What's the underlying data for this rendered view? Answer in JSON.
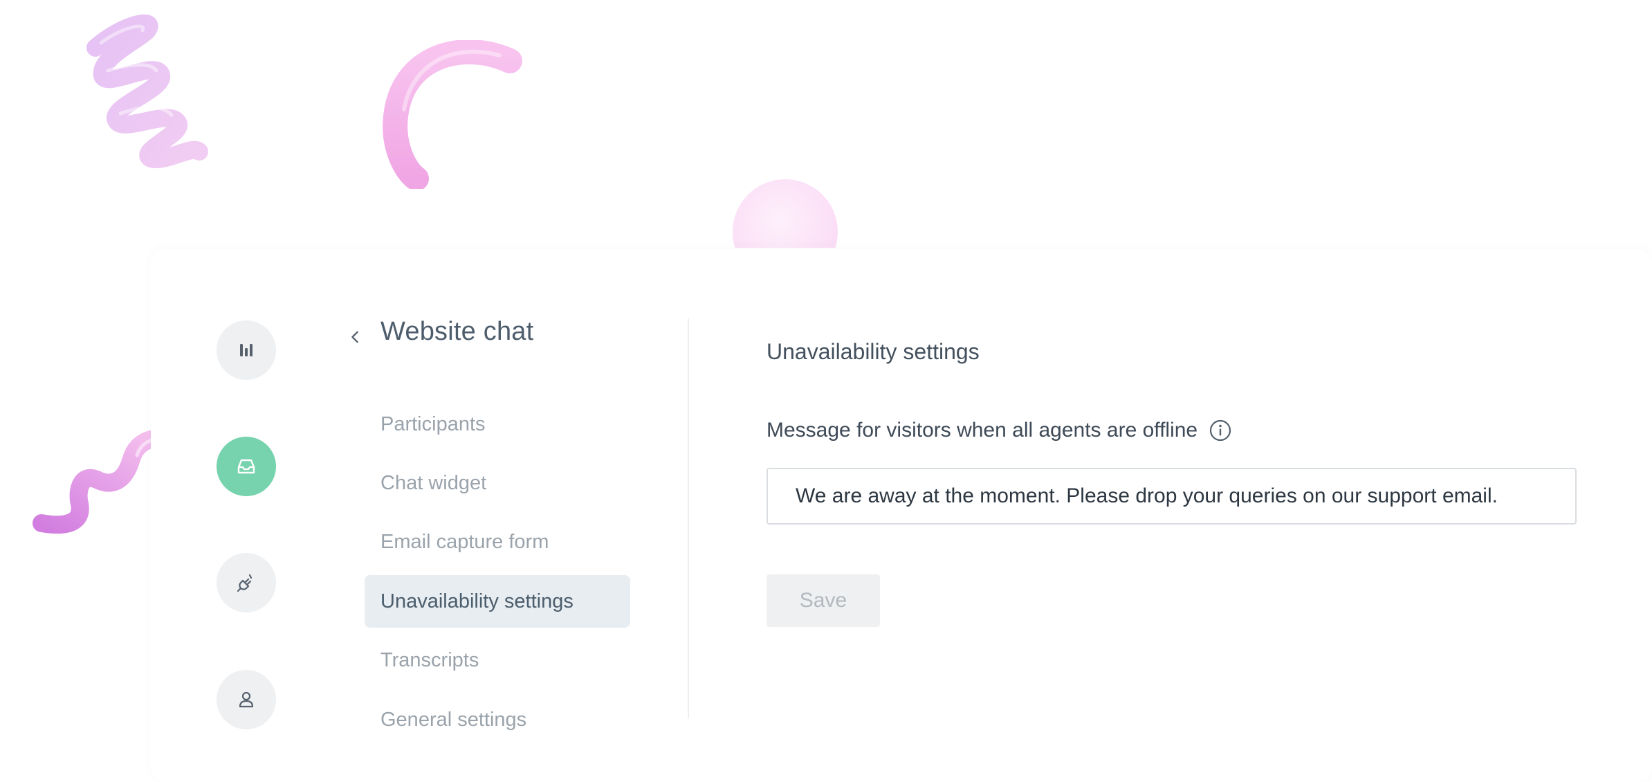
{
  "rail": {
    "items": [
      {
        "name": "Dashboard",
        "icon": "bars-icon",
        "active": false
      },
      {
        "name": "Inbox",
        "icon": "inbox-icon",
        "active": true
      },
      {
        "name": "Integrations",
        "icon": "plug-icon",
        "active": false
      },
      {
        "name": "Profile",
        "icon": "user-icon",
        "active": false
      }
    ]
  },
  "nav": {
    "back_icon": "chevron-left-icon",
    "title": "Website chat",
    "items": [
      {
        "label": "Participants",
        "active": false
      },
      {
        "label": "Chat widget",
        "active": false
      },
      {
        "label": "Email capture form",
        "active": false
      },
      {
        "label": "Unavailability settings",
        "active": true
      },
      {
        "label": "Transcripts",
        "active": false
      },
      {
        "label": "General settings",
        "active": false
      }
    ]
  },
  "main": {
    "section_title": "Unavailability settings",
    "field_label": "Message for visitors when all agents are offline",
    "info_icon": "info-icon",
    "message_value": "We are away at the moment. Please drop your queries on our support email.",
    "save_label": "Save"
  },
  "colors": {
    "accent": "#76d3ae",
    "active_nav_bg": "#e7edf1",
    "decor_pink": "#f4b6ea",
    "decor_purple": "#d98ce6"
  }
}
